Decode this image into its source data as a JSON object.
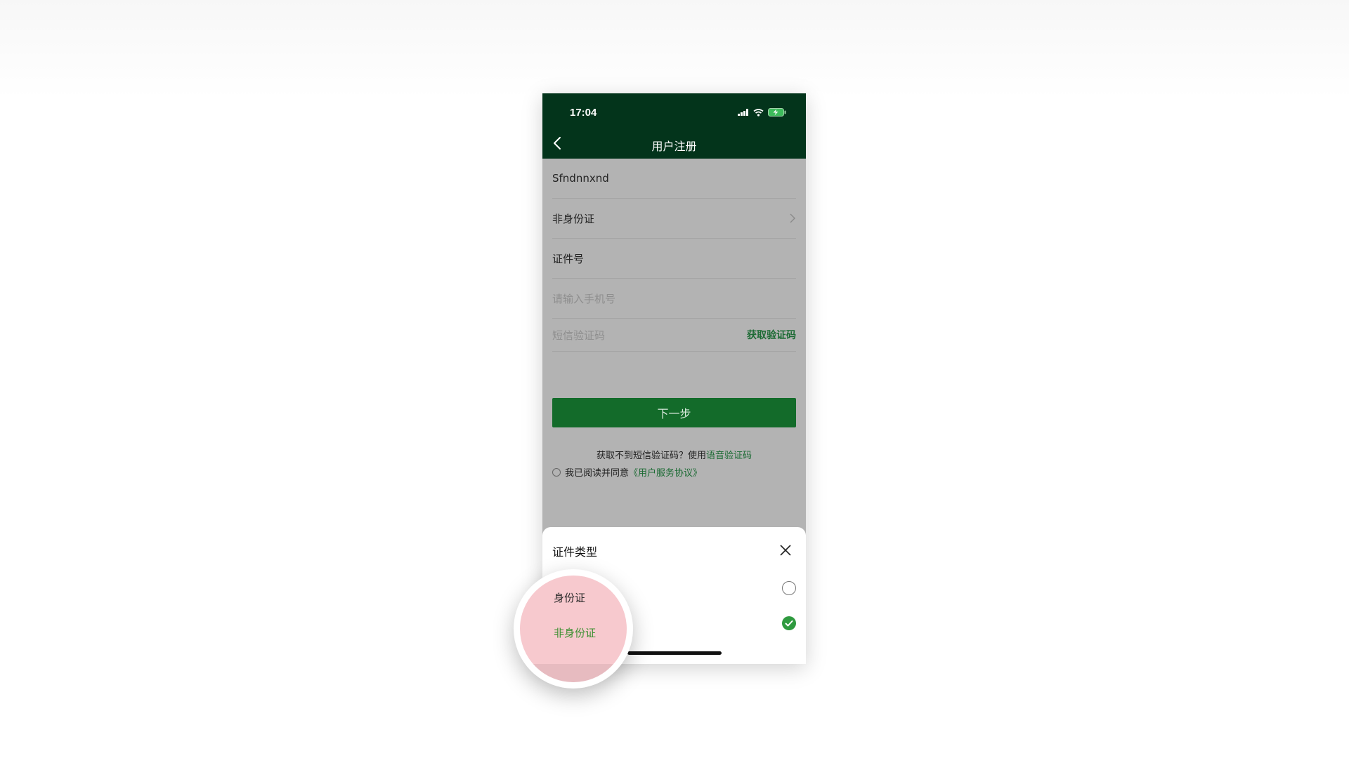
{
  "status_bar": {
    "time": "17:04"
  },
  "nav": {
    "title": "用户注册"
  },
  "form": {
    "name_value": "Sfndnnxnd",
    "id_type_value": "非身份证",
    "id_number_label": "证件号",
    "phone_placeholder": "请输入手机号",
    "sms_placeholder": "短信验证码",
    "get_code_label": "获取验证码"
  },
  "agreement": {
    "text": "我已阅读并同意",
    "link": "《用户服务协议》"
  },
  "next_button": {
    "label": "下一步"
  },
  "hint": {
    "text": "获取不到短信验证码？使用",
    "link": "语音验证码"
  },
  "sheet": {
    "title": "证件类型",
    "options": [
      {
        "label": "身份证",
        "selected": false
      },
      {
        "label": "非身份证",
        "selected": true
      }
    ]
  },
  "colors": {
    "nav_bg": "#03341b",
    "accent": "#136b2a",
    "selected_text": "#3a8f2f"
  },
  "icons": [
    "back-icon",
    "close-icon",
    "check-icon",
    "chevron-right-icon",
    "signal-icon",
    "wifi-icon",
    "battery-icon"
  ]
}
